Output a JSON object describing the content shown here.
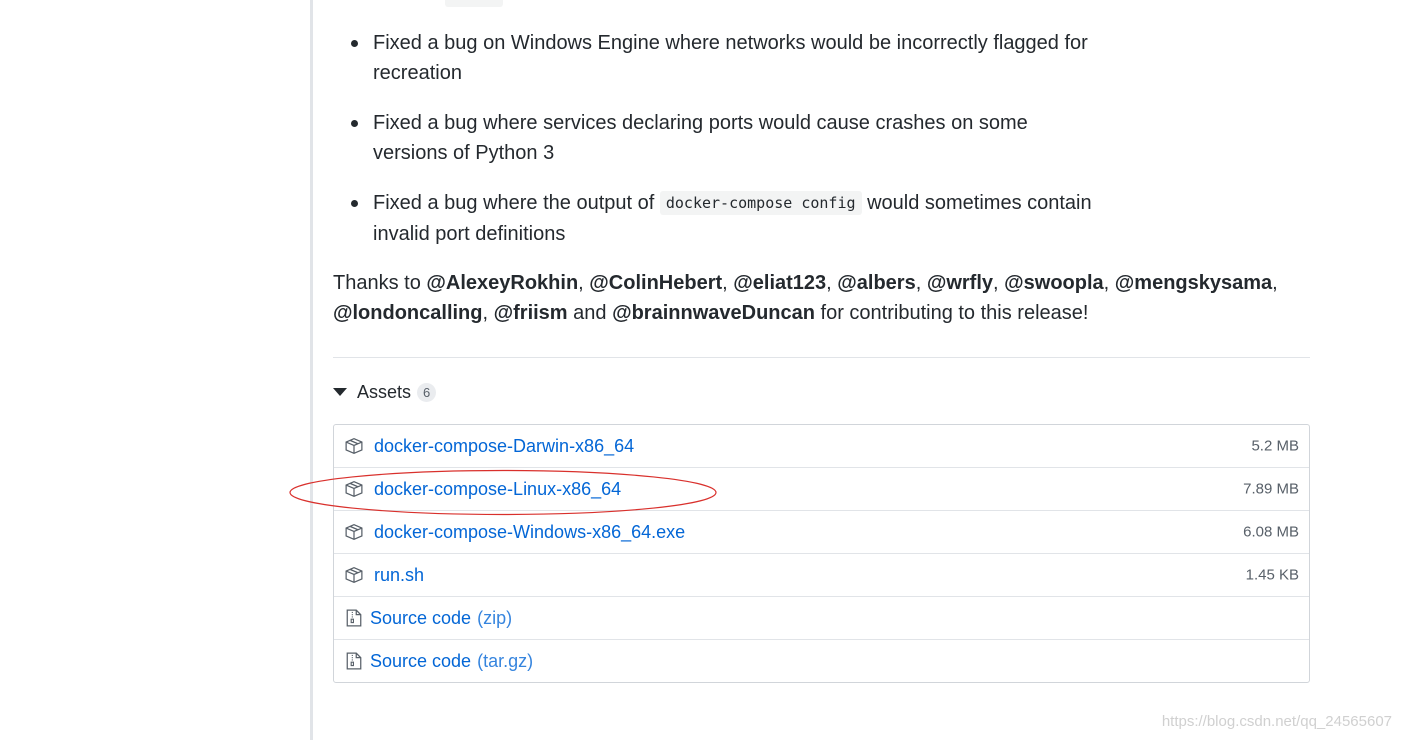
{
  "changelog": [
    {
      "text": "Fixed a bug on Windows Engine where networks would be incorrectly flagged for recreation"
    },
    {
      "text": "Fixed a bug where services declaring ports would cause crashes on some versions of Python 3"
    },
    {
      "prefix": "Fixed a bug where the output of ",
      "code": "docker-compose config",
      "suffix": " would sometimes contain invalid port definitions"
    }
  ],
  "thanks": {
    "prefix": "Thanks to ",
    "contributors": [
      "@AlexeyRokhin",
      "@ColinHebert",
      "@eliat123",
      "@albers",
      "@wrfly",
      "@swoopla",
      "@mengskysama",
      "@londoncalling",
      "@friism"
    ],
    "and_word": " and ",
    "last": "@brainnwaveDuncan",
    "suffix": " for contributing to this release!"
  },
  "assets": {
    "label": "Assets",
    "count": "6",
    "items": [
      {
        "name": "docker-compose-Darwin-x86_64",
        "size": "5.2 MB",
        "icon": "package-icon"
      },
      {
        "name": "docker-compose-Linux-x86_64",
        "size": "7.89 MB",
        "icon": "package-icon"
      },
      {
        "name": "docker-compose-Windows-x86_64.exe",
        "size": "6.08 MB",
        "icon": "package-icon"
      },
      {
        "name": "run.sh",
        "size": "1.45 KB",
        "icon": "package-icon"
      }
    ],
    "sources": [
      {
        "name": "Source code",
        "suffix": "(zip)",
        "icon": "file-zip-icon"
      },
      {
        "name": "Source code",
        "suffix": "(tar.gz)",
        "icon": "file-zip-icon"
      }
    ]
  },
  "highlight_color": "#d9302c",
  "link_color": "#0366d6",
  "watermark": "https://blog.csdn.net/qq_24565607"
}
